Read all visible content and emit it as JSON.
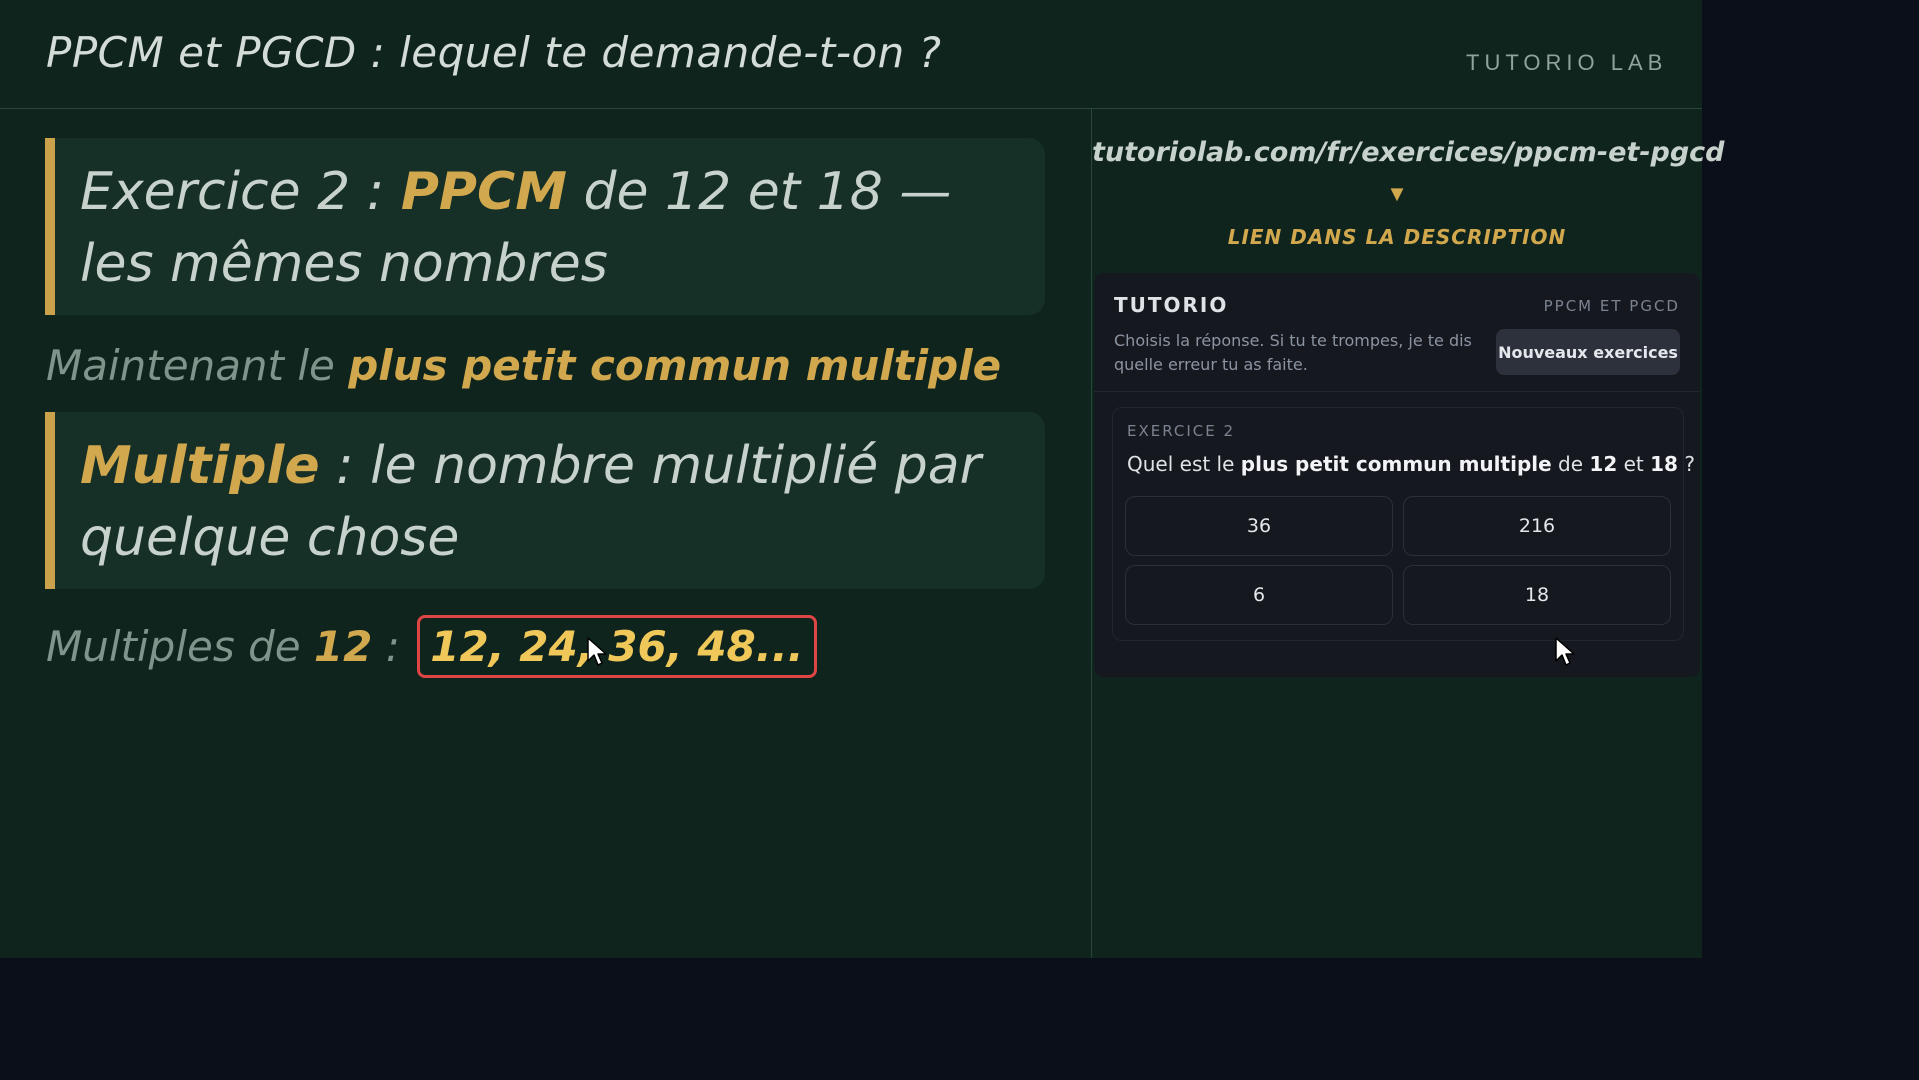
{
  "header": {
    "title": "PPCM et PGCD : lequel te demande-t-on ?",
    "brand": "TUTORIO LAB"
  },
  "lesson": {
    "callout1": {
      "prefix": "Exercice 2 : ",
      "highlight": "PPCM",
      "suffix": " de 12 et 18 —",
      "line2": "les mêmes nombres"
    },
    "subline1": {
      "prefix": "Maintenant le ",
      "highlight": "plus petit commun multiple"
    },
    "callout2": {
      "highlight": "Multiple",
      "suffix": " : le nombre multiplié par",
      "line2": "quelque chose"
    },
    "subline2": {
      "prefix": "Multiples de ",
      "number": "12",
      "sep": " :",
      "values": "12, 24, 36, 48..."
    }
  },
  "sidebar": {
    "url": "tutoriolab.com/fr/exercices/ppcm-et-pgcd",
    "arrow": "▼",
    "link_hint": "LIEN DANS LA DESCRIPTION"
  },
  "card": {
    "brand": "TUTORIO",
    "topic": "PPCM ET PGCD",
    "description": "Choisis la réponse. Si tu te trompes, je te dis quelle erreur tu as faite.",
    "new_button": "Nouveaux exercices",
    "exercise": {
      "label": "EXERCICE 2",
      "question": {
        "q1": "Quel est le ",
        "q2": "plus petit commun multiple",
        "q3": " de ",
        "q4": "12",
        "q5": " et ",
        "q6": "18",
        "q7": " ?"
      },
      "answers": [
        "36",
        "216",
        "6",
        "18"
      ]
    }
  },
  "colors": {
    "board": "#10241e",
    "accent_gold": "#d1a84d",
    "highlight_border": "#e04545",
    "card_bg": "#15181e"
  },
  "icons": {
    "cursor": "cursor-arrow-icon",
    "arrow": "arrow-down-icon"
  }
}
